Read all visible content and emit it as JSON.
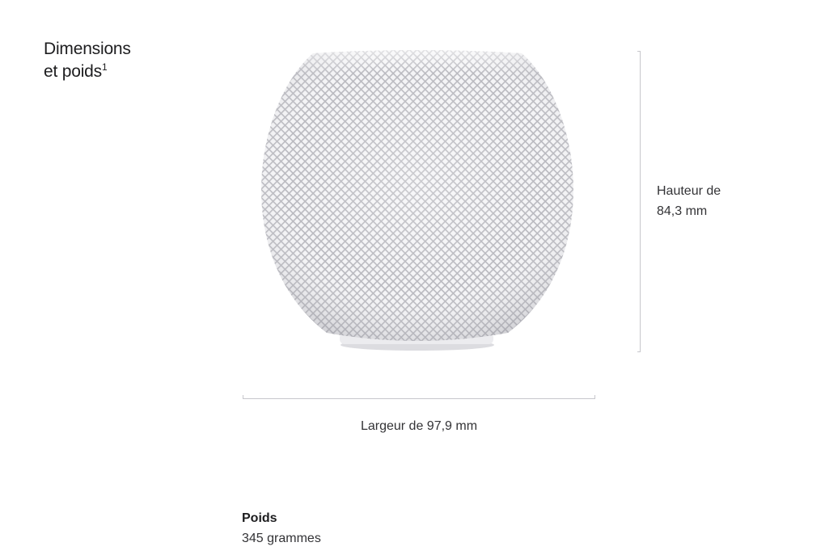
{
  "section": {
    "title_line1": "Dimensions",
    "title_line2": "et poids",
    "footnote_mark": "1"
  },
  "product": {
    "image_icon": "homepod-mini-speaker-image"
  },
  "dimensions": {
    "height_label_line1": "Hauteur de",
    "height_label_line2": "84,3 mm",
    "width_label": "Largeur de 97,9 mm"
  },
  "weight": {
    "heading": "Poids",
    "value": "345 grammes"
  },
  "colors": {
    "text": "#1d1d1f",
    "secondary_text": "#333336",
    "ruler": "#c7c7cc",
    "speaker_mesh": "#e8e8ea"
  }
}
